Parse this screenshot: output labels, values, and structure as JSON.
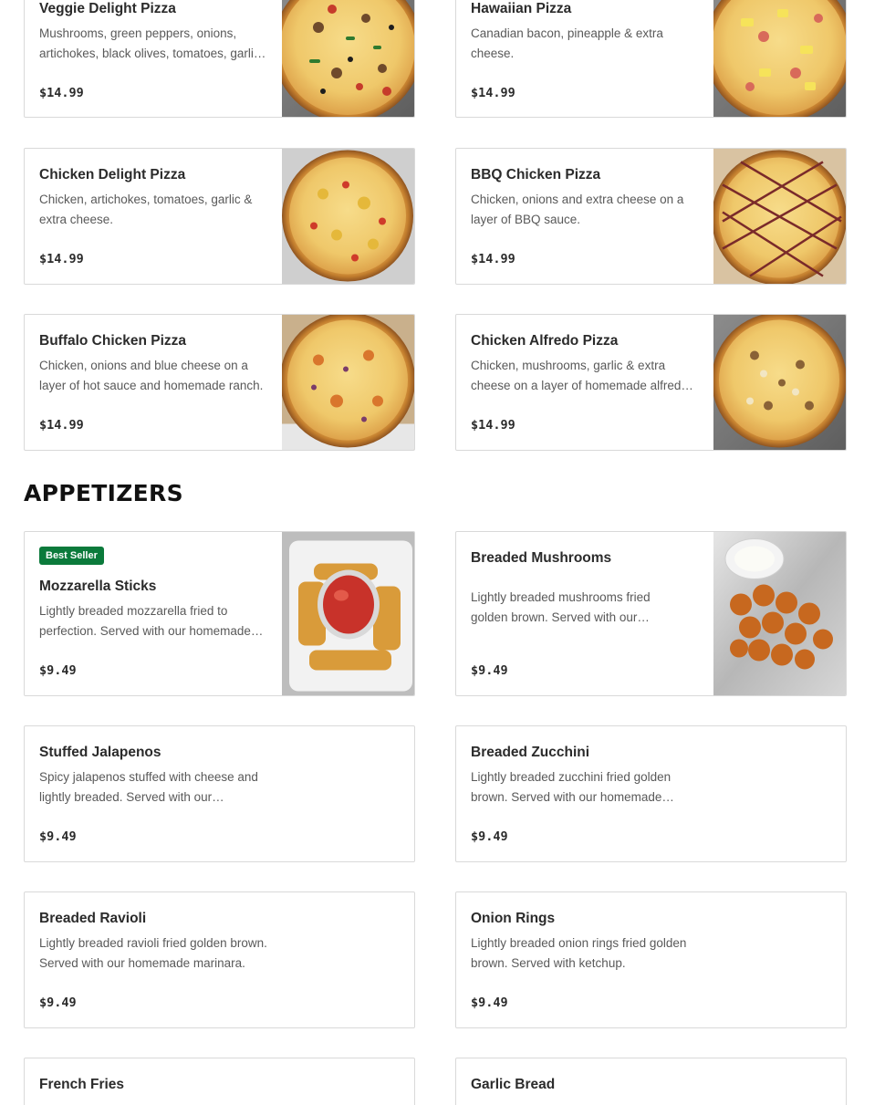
{
  "pizzas": [
    {
      "name": "Veggie Delight Pizza",
      "description": "Mushrooms, green peppers, onions, artichokes, black olives, tomatoes, garlic & extra cheese.",
      "price": "$14.99",
      "image": "veggie-pizza-photo"
    },
    {
      "name": "Hawaiian Pizza",
      "description": "Canadian bacon, pineapple & extra cheese.",
      "price": "$14.99",
      "image": "hawaiian-pizza-photo"
    },
    {
      "name": "Chicken Delight Pizza",
      "description": "Chicken, artichokes, tomatoes, garlic & extra cheese.",
      "price": "$14.99",
      "image": "chicken-delight-pizza-photo"
    },
    {
      "name": "BBQ Chicken Pizza",
      "description": "Chicken, onions and extra cheese on a layer of BBQ sauce.",
      "price": "$14.99",
      "image": "bbq-chicken-pizza-photo"
    },
    {
      "name": "Buffalo Chicken Pizza",
      "description": "Chicken, onions and blue cheese on a layer of hot sauce and homemade ranch.",
      "price": "$14.99",
      "image": "buffalo-chicken-pizza-photo"
    },
    {
      "name": "Chicken Alfredo Pizza",
      "description": "Chicken, mushrooms, garlic & extra cheese on a layer of homemade alfredo sauce.",
      "price": "$14.99",
      "image": "chicken-alfredo-pizza-photo"
    }
  ],
  "appetizers_section": {
    "title": "APPETIZERS"
  },
  "appetizers": [
    {
      "name": "Mozzarella Sticks",
      "badge": "Best Seller",
      "description": "Lightly breaded mozzarella fried to perfection. Served with our homemade marinara.",
      "price": "$9.49",
      "image": "mozzarella-sticks-photo"
    },
    {
      "name": "Breaded Mushrooms",
      "description": "Lightly breaded mushrooms fried golden brown. Served with our homemade ranch.",
      "price": "$9.49",
      "image": "breaded-mushrooms-photo"
    },
    {
      "name": "Stuffed Jalapenos",
      "description": "Spicy jalapenos stuffed with cheese and lightly breaded. Served with our homemade ranch.",
      "price": "$9.49"
    },
    {
      "name": "Breaded Zucchini",
      "description": "Lightly breaded zucchini fried golden brown. Served with our homemade ranch.",
      "price": "$9.49"
    },
    {
      "name": "Breaded Ravioli",
      "description": "Lightly breaded ravioli fried golden brown. Served with our homemade marinara.",
      "price": "$9.49"
    },
    {
      "name": "Onion Rings",
      "description": "Lightly breaded onion rings fried golden brown. Served with ketchup.",
      "price": "$9.49"
    },
    {
      "name": "French Fries"
    },
    {
      "name": "Garlic Bread"
    }
  ],
  "colors": {
    "badge": "#0b7a3b",
    "card_border": "#d9d9d9",
    "text": "#2b2b2b",
    "muted": "#595959"
  }
}
